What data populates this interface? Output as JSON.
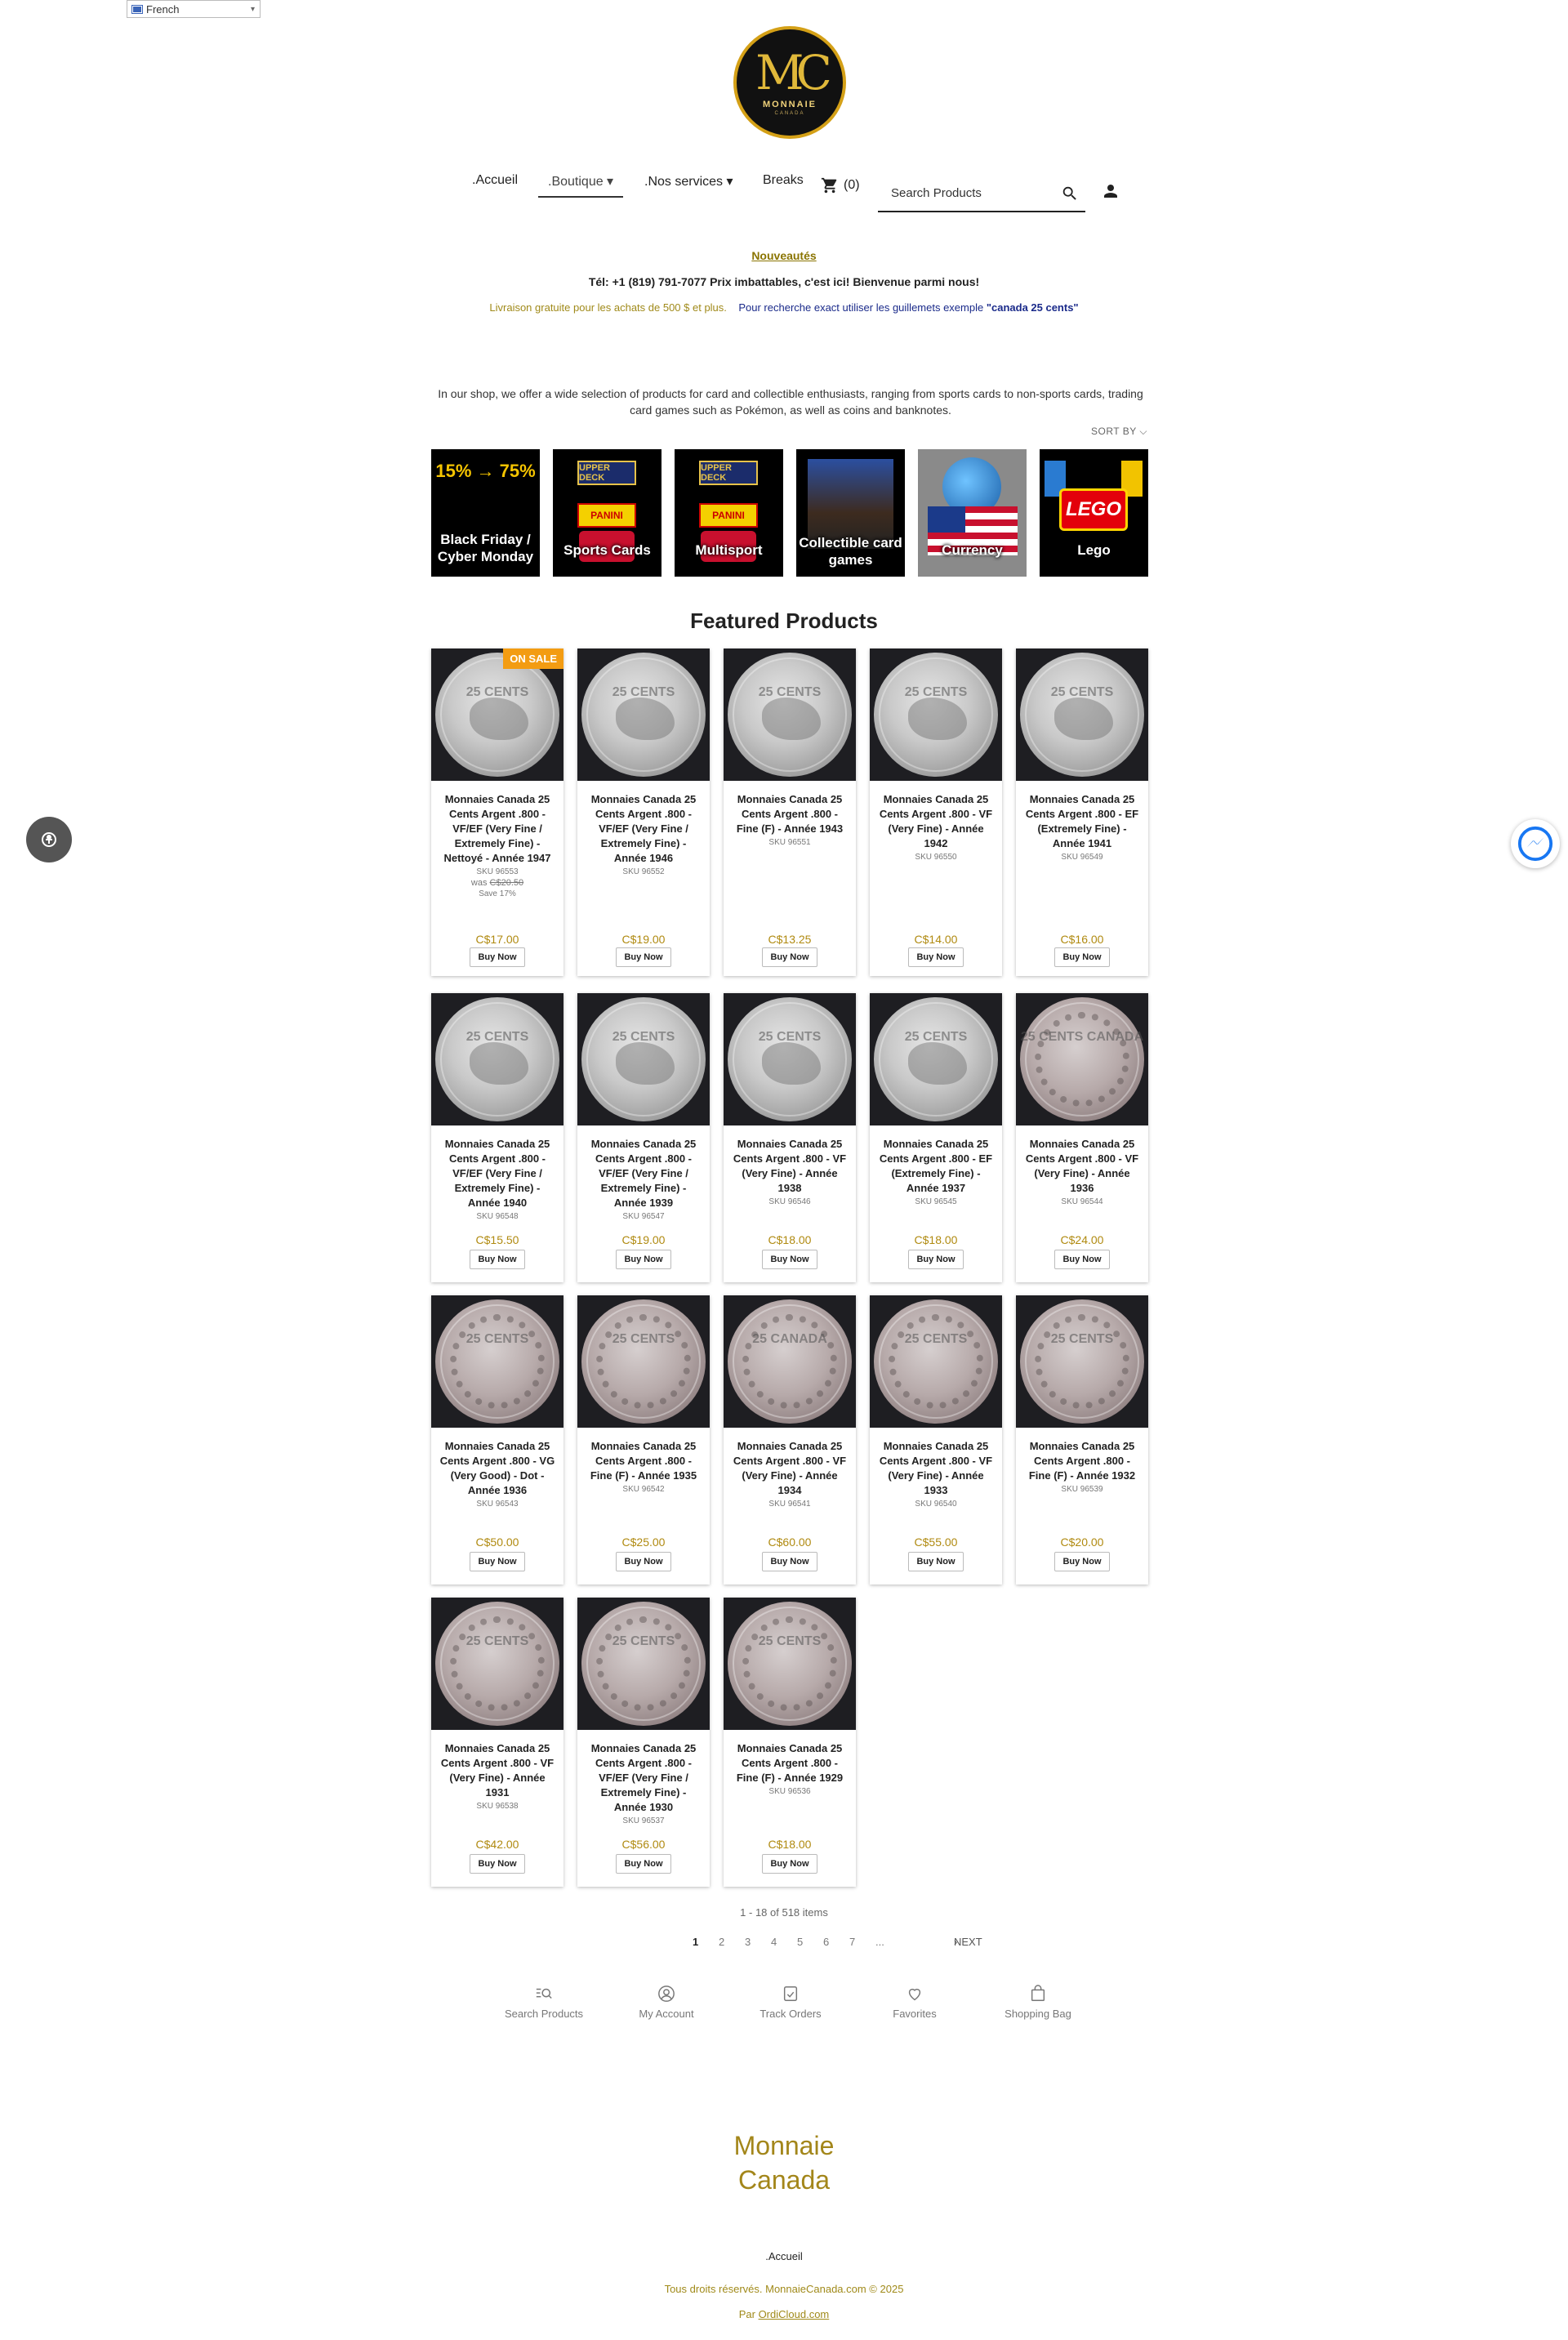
{
  "language": {
    "selected": "French",
    "flag_icon": "flag-icon",
    "chevron_icon": "chevron-down-icon"
  },
  "logo": {
    "mark": "MC",
    "word": "MONNAIE",
    "sub": "CANADA"
  },
  "nav": {
    "items": [
      {
        "label": ".Accueil",
        "name": "nav-accueil"
      },
      {
        "label": ".Boutique ▾",
        "name": "nav-boutique"
      },
      {
        "label": ".Nos services ▾",
        "name": "nav-services"
      },
      {
        "label": "Breaks",
        "name": "nav-breaks"
      }
    ],
    "cart_count": "(0)",
    "search_placeholder": "Search Products"
  },
  "info": {
    "nouveautes": "Nouveautés",
    "tel_line": "Tél: +1 (819) 791-7077    Prix imbattables, c'est ici!  Bienvenue parmi nous!",
    "shipping": "Livraison gratuite pour les achats de 500 $ et plus.",
    "search_tip": "Pour recherche exact utiliser les guillemets exemple ",
    "search_example": "\"canada 25 cents\""
  },
  "intro": "In our shop, we offer a wide selection of products for card and collectible enthusiasts, ranging from sports cards to non-sports cards, trading card games such as Pokémon, as well as coins and banknotes.",
  "sort_by": "SORT BY",
  "categories": [
    {
      "label": "Black Friday / Cyber Monday",
      "badge": "15% → 75%"
    },
    {
      "label": "Sports Cards",
      "brand1": "UPPER DECK",
      "brand2": "PANINI"
    },
    {
      "label": "Multisport",
      "brand1": "UPPER DECK",
      "brand2": "PANINI"
    },
    {
      "label": "Collectible card games"
    },
    {
      "label": "Currency"
    },
    {
      "label": "Lego",
      "brand": "LEGO"
    }
  ],
  "featured_title": "Featured Products",
  "sale_badge": "ON SALE",
  "buy_label": "Buy Now",
  "products": [
    {
      "title": "Monnaies Canada 25 Cents Argent .800 - VF/EF (Very Fine / Extremely Fine) - Nettoyé - Année 1947",
      "sku": "SKU 96553",
      "was": "was ",
      "was_price": "C$20.50",
      "save": "Save 17%",
      "price": "C$17.00",
      "coin": "25 CENTS"
    },
    {
      "title": "Monnaies Canada 25 Cents Argent .800 - VF/EF (Very Fine / Extremely Fine) - Année 1946",
      "sku": "SKU 96552",
      "price": "C$19.00",
      "coin": "25 CENTS"
    },
    {
      "title": "Monnaies Canada 25 Cents Argent .800 - Fine (F) - Année 1943",
      "sku": "SKU 96551",
      "price": "C$13.25",
      "coin": "25 CENTS"
    },
    {
      "title": "Monnaies Canada 25 Cents Argent .800 - VF (Very Fine) - Année 1942",
      "sku": "SKU 96550",
      "price": "C$14.00",
      "coin": "25 CENTS"
    },
    {
      "title": "Monnaies Canada 25 Cents Argent .800 - EF (Extremely Fine) - Année 1941",
      "sku": "SKU 96549",
      "price": "C$16.00",
      "coin": "25 CENTS"
    },
    {
      "title": "Monnaies Canada 25 Cents Argent .800 - VF/EF (Very Fine / Extremely Fine) - Année 1940",
      "sku": "SKU 96548",
      "price": "C$15.50",
      "coin": "25 CENTS"
    },
    {
      "title": "Monnaies Canada 25 Cents Argent .800 - VF/EF (Very Fine / Extremely Fine) - Année 1939",
      "sku": "SKU 96547",
      "price": "C$19.00",
      "coin": "25 CENTS"
    },
    {
      "title": "Monnaies Canada 25 Cents Argent .800 - VF (Very Fine) - Année 1938",
      "sku": "SKU 96546",
      "price": "C$18.00",
      "coin": "25 CENTS"
    },
    {
      "title": "Monnaies Canada 25 Cents Argent .800 - EF (Extremely Fine) - Année 1937",
      "sku": "SKU 96545",
      "price": "C$18.00",
      "coin": "25 CENTS"
    },
    {
      "title": "Monnaies Canada 25 Cents Argent .800 - VF (Very Fine) - Année 1936",
      "sku": "SKU 96544",
      "price": "C$24.00",
      "coin": "25 CENTS CANADA"
    },
    {
      "title": "Monnaies Canada 25 Cents Argent .800 - VG (Very Good) - Dot - Année 1936",
      "sku": "SKU 96543",
      "price": "C$50.00",
      "coin": "25 CENTS"
    },
    {
      "title": "Monnaies Canada 25 Cents Argent .800 - Fine (F) - Année 1935",
      "sku": "SKU 96542",
      "price": "C$25.00",
      "coin": "25 CENTS"
    },
    {
      "title": "Monnaies Canada 25 Cents Argent .800 - VF (Very Fine) - Année 1934",
      "sku": "SKU 96541",
      "price": "C$60.00",
      "coin": "25 CANADA"
    },
    {
      "title": "Monnaies Canada 25 Cents Argent .800 - VF (Very Fine) - Année 1933",
      "sku": "SKU 96540",
      "price": "C$55.00",
      "coin": "25 CENTS"
    },
    {
      "title": "Monnaies Canada 25 Cents Argent .800 - Fine (F) - Année 1932",
      "sku": "SKU 96539",
      "price": "C$20.00",
      "coin": "25 CENTS"
    },
    {
      "title": "Monnaies Canada 25 Cents Argent .800 - VF (Very Fine) - Année 1931",
      "sku": "SKU 96538",
      "price": "C$42.00",
      "coin": "25 CENTS"
    },
    {
      "title": "Monnaies Canada 25 Cents Argent .800 - VF/EF (Very Fine / Extremely Fine) - Année 1930",
      "sku": "SKU 96537",
      "price": "C$56.00",
      "coin": "25 CENTS"
    },
    {
      "title": "Monnaies Canada 25 Cents Argent .800 - Fine (F) - Année 1929",
      "sku": "SKU 96536",
      "price": "C$18.00",
      "coin": "25 CENTS"
    }
  ],
  "items_count": "1 - 18 of 518 items",
  "pagination": {
    "pages": [
      "1",
      "2",
      "3",
      "4",
      "5",
      "6",
      "7",
      "..."
    ],
    "next": "NEXT"
  },
  "bottom_nav": [
    {
      "label": "Search Products",
      "icon": "search-list-icon"
    },
    {
      "label": "My Account",
      "icon": "account-icon"
    },
    {
      "label": "Track Orders",
      "icon": "track-orders-icon"
    },
    {
      "label": "Favorites",
      "icon": "heart-icon"
    },
    {
      "label": "Shopping Bag",
      "icon": "bag-icon"
    }
  ],
  "footer": {
    "brand_line1": "Monnaie",
    "brand_line2": "Canada",
    "accueil": ".Accueil",
    "copyright": "Tous droits réservés. MonnaieCanada.com © 2025",
    "by": "Par ",
    "by_link": "OrdiCloud.com"
  },
  "colors": {
    "gold": "#b08a10",
    "sale": "#f39c12",
    "link_blue": "#1a2a8a",
    "messenger": "#1877f2"
  }
}
